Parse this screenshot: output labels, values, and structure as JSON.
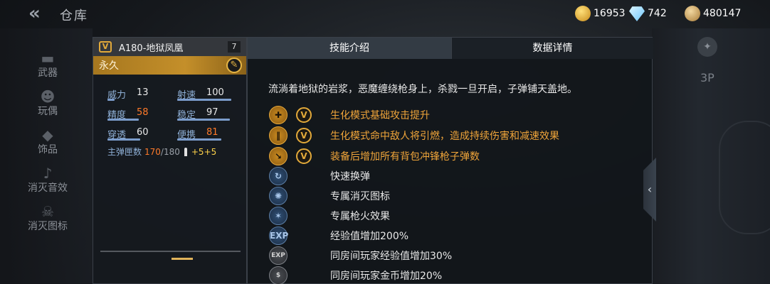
{
  "topbar": {
    "title": "仓库",
    "back_icon": "double-chevron-left-icon",
    "currencies": [
      {
        "name": "gold",
        "icon": "gold-plus-icon",
        "value": "16953"
      },
      {
        "name": "diamond",
        "icon": "diamond-icon",
        "value": "742"
      },
      {
        "name": "coin",
        "icon": "coin-icon",
        "value": "480147"
      }
    ]
  },
  "side_nav": {
    "items": [
      {
        "label": "武器"
      },
      {
        "label": "玩偶"
      },
      {
        "label": "饰品"
      },
      {
        "label": "消灭音效"
      },
      {
        "label": "消灭图标"
      }
    ]
  },
  "weapon_card": {
    "badge": "V",
    "name": "A180-地狱凤凰",
    "level": "7",
    "duration": "永久",
    "stats": [
      {
        "label": "威力",
        "value": "13",
        "fill": 0.13,
        "highlight": false
      },
      {
        "label": "射速",
        "value": "100",
        "fill": 1.0,
        "highlight": false
      },
      {
        "label": "精度",
        "value": "58",
        "fill": 0.58,
        "highlight": true
      },
      {
        "label": "稳定",
        "value": "97",
        "fill": 0.97,
        "highlight": false
      },
      {
        "label": "穿透",
        "value": "60",
        "fill": 0.6,
        "highlight": false
      },
      {
        "label": "便携",
        "value": "81",
        "fill": 0.81,
        "highlight": true
      }
    ],
    "ammo_label": "主弹匣数",
    "ammo_current": "170",
    "ammo_sep": "/",
    "ammo_max": "180",
    "ammo_bonus": "+5+5"
  },
  "panel": {
    "tabs": [
      {
        "label": "技能介绍",
        "active": true
      },
      {
        "label": "数据详情",
        "active": false
      }
    ],
    "description": "流淌着地狱的岩浆，恶魔缠绕枪身上，杀戮一旦开启，子弹铺天盖地。",
    "skills": [
      {
        "text": "生化模式基础攻击提升",
        "icon": "syringe-icon",
        "has_v": true,
        "color": "gold"
      },
      {
        "text": "生化模式命中敌人将引燃，造成持续伤害和减速效果",
        "icon": "bullets-icon",
        "has_v": true,
        "color": "gold"
      },
      {
        "text": "装备后增加所有背包冲锋枪子弹数",
        "icon": "smg-icon",
        "has_v": true,
        "color": "gold"
      },
      {
        "text": "快速换弹",
        "icon": "reload-icon",
        "has_v": false,
        "color": "blue"
      },
      {
        "text": "专属消灭图标",
        "icon": "kill-icon",
        "has_v": false,
        "color": "blue"
      },
      {
        "text": "专属枪火效果",
        "icon": "muzzle-flash-icon",
        "has_v": false,
        "color": "blue"
      },
      {
        "text": "经验值增加200%",
        "icon": "exp-up-icon",
        "has_v": false,
        "color": "blue"
      },
      {
        "text": "同房间玩家经验值增加30%",
        "icon": "exp-share-icon",
        "has_v": false,
        "color": "grey"
      },
      {
        "text": "同房间玩家金币增加20%",
        "icon": "coin-share-icon",
        "has_v": false,
        "color": "grey"
      }
    ]
  },
  "right_deco": {
    "view_label": "3P"
  }
}
